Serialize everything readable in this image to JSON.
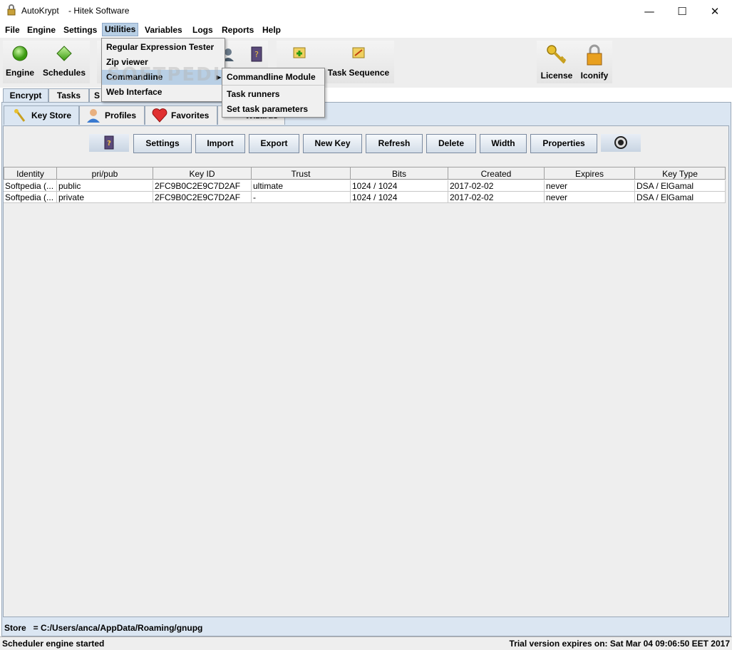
{
  "window": {
    "title": "AutoKrypt    - Hitek Software",
    "minimize": "—",
    "maximize": "☐",
    "close": "✕"
  },
  "menubar": [
    {
      "label": "File"
    },
    {
      "label": "Engine"
    },
    {
      "label": "Settings"
    },
    {
      "label": "Utilities"
    },
    {
      "label": "Variables"
    },
    {
      "label": "Logs"
    },
    {
      "label": "Reports"
    },
    {
      "label": "Help"
    }
  ],
  "toolbar": {
    "engine": "Engine",
    "schedules": "Schedules",
    "task_sequence": "Task Sequence",
    "license": "License",
    "iconify": "Iconify"
  },
  "utilities_menu": [
    {
      "label": "Regular Expression Tester"
    },
    {
      "label": "Zip viewer"
    },
    {
      "label": "Commandline"
    },
    {
      "label": "Web Interface"
    }
  ],
  "commandline_submenu": [
    {
      "label": "Commandline Module"
    },
    {
      "label": "Task runners"
    },
    {
      "label": "Set task parameters"
    }
  ],
  "watermark": "SOFTPEDIA",
  "tabs_top": [
    {
      "label": "Encrypt"
    },
    {
      "label": "Tasks"
    },
    {
      "label": "S"
    }
  ],
  "tabs_second": [
    {
      "label": "Key Store"
    },
    {
      "label": "Profiles"
    },
    {
      "label": "Favorites"
    },
    {
      "label": "Wizards"
    }
  ],
  "actions": {
    "settings": "Settings",
    "import": "Import",
    "export": "Export",
    "new_key": "New Key",
    "refresh": "Refresh",
    "delete": "Delete",
    "width": "Width",
    "properties": "Properties"
  },
  "table": {
    "columns": [
      "Identity",
      "pri/pub",
      "Key ID",
      "Trust",
      "Bits",
      "Created",
      "Expires",
      "Key Type"
    ],
    "rows": [
      [
        "Softpedia (...",
        "public",
        "2FC9B0C2E9C7D2AF",
        "ultimate",
        "1024 / 1024",
        "2017-02-02",
        "never",
        "DSA / ElGamal"
      ],
      [
        "Softpedia (...",
        "private",
        "2FC9B0C2E9C7D2AF",
        "-",
        "1024 / 1024",
        "2017-02-02",
        "never",
        "DSA / ElGamal"
      ]
    ]
  },
  "store_path": "Store   = C:/Users/anca/AppData/Roaming/gnupg",
  "status": {
    "left": "Scheduler engine started",
    "right": "Trial version expires on: Sat Mar 04 09:06:50 EET 2017"
  },
  "colors": {
    "menu_highlight": "#b8cfe5",
    "panel_bg": "#eeeeee",
    "tab_selected": "#dbe6f2"
  }
}
